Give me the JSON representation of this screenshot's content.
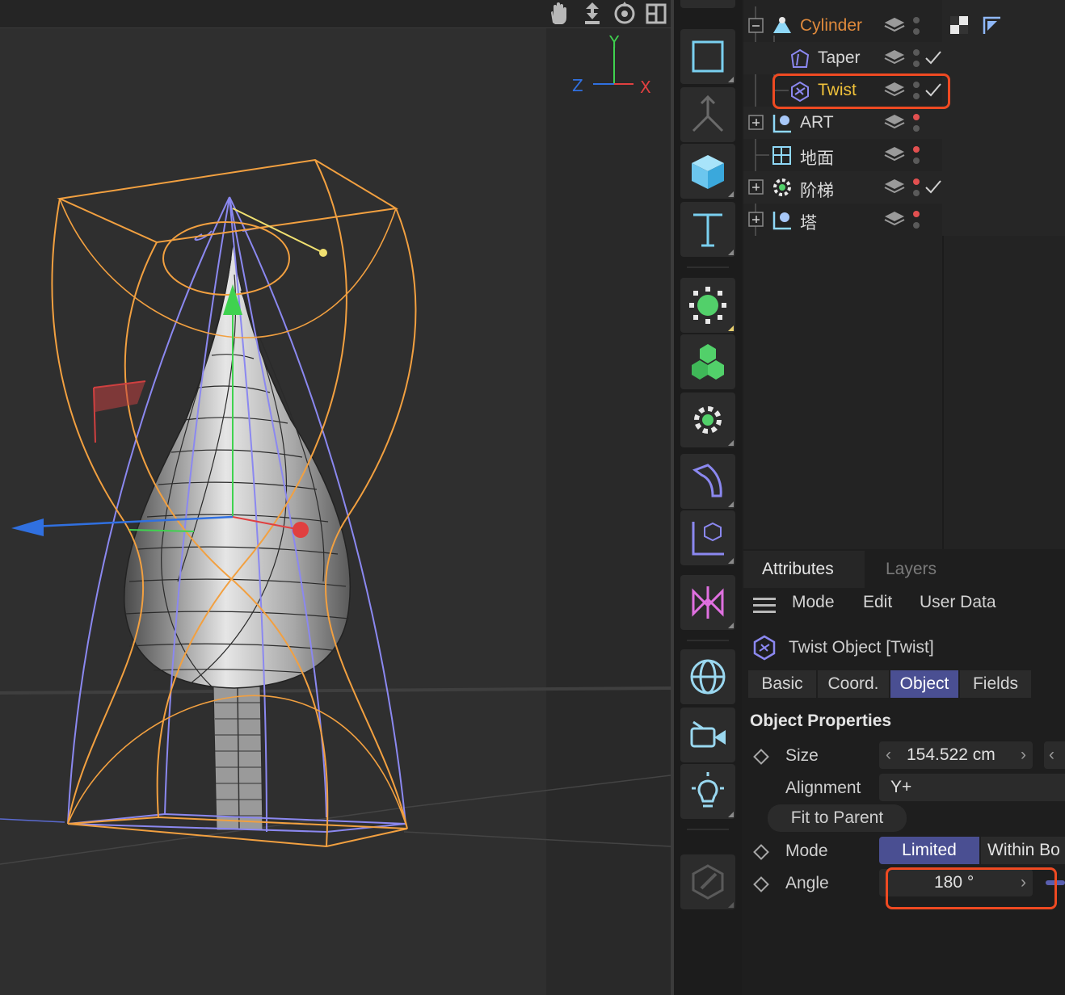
{
  "object_manager": {
    "objects": [
      {
        "name": "Cylinder",
        "color": "#e08a3c"
      },
      {
        "name": "Taper",
        "color": "#d8d8d8"
      },
      {
        "name": "Twist",
        "color": "#f0c23a"
      },
      {
        "name": "ART",
        "color": "#d8d8d8"
      },
      {
        "name": "地面",
        "color": "#d8d8d8"
      },
      {
        "name": "阶梯",
        "color": "#d8d8d8"
      },
      {
        "name": "塔",
        "color": "#d8d8d8"
      }
    ]
  },
  "viewport": {
    "axis_labels": {
      "y": "Y",
      "x": "X",
      "z": "Z"
    }
  },
  "attributes": {
    "tabs": [
      "Attributes",
      "Layers"
    ],
    "menu": [
      "Mode",
      "Edit",
      "User Data"
    ],
    "object_title": "Twist Object [Twist]",
    "sub_tabs": [
      "Basic",
      "Coord.",
      "Object",
      "Fields"
    ],
    "active_sub_tab": "Object",
    "section_title": "Object Properties",
    "size": {
      "label": "Size",
      "value": "154.522 cm"
    },
    "alignment": {
      "label": "Alignment",
      "value": "Y+"
    },
    "fit_button": "Fit to Parent",
    "mode": {
      "label": "Mode",
      "options": [
        "Limited",
        "Within Bo"
      ],
      "selected": "Limited"
    },
    "angle": {
      "label": "Angle",
      "value": "180 °"
    }
  },
  "colors": {
    "accent": "#4a4f92",
    "highlight": "#ef4a22",
    "deformer": "#8b88f0",
    "bbox": "#f2a040"
  }
}
